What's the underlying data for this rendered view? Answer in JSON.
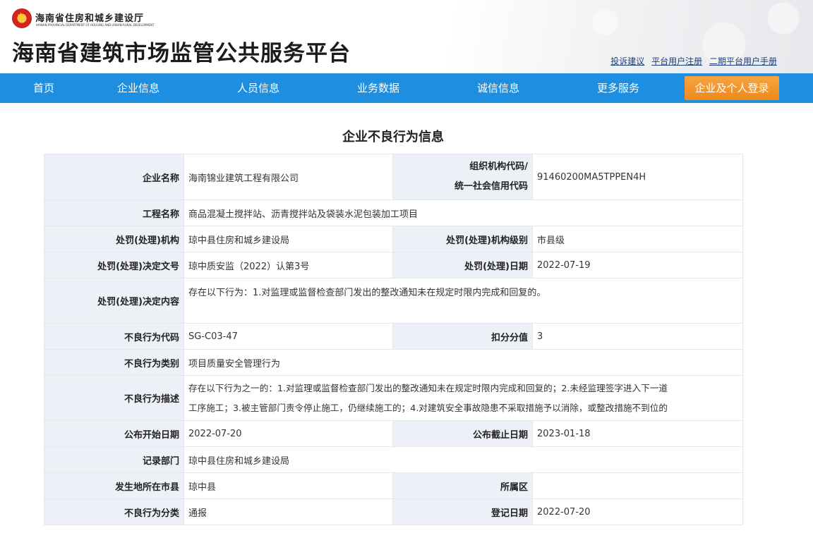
{
  "header": {
    "dept_cn": "海南省住房和城乡建设厅",
    "dept_en": "HAINAN PROVINCIAL DEPARTMENT OF HOUSING AND URBAN-RURAL DEVELOPMENT",
    "site_title": "海南省建筑市场监管公共服务平台",
    "links": [
      "投诉建议",
      "平台用户注册",
      "二期平台用户手册"
    ]
  },
  "nav": {
    "items": [
      "首页",
      "企业信息",
      "人员信息",
      "业务数据",
      "诚信信息",
      "更多服务"
    ],
    "login": "企业及个人登录"
  },
  "page": {
    "title": "企业不良行为信息"
  },
  "fields": {
    "company_name": {
      "label": "企业名称",
      "value": "海南锦业建筑工程有限公司"
    },
    "org_code": {
      "label_line1": "组织机构代码/",
      "label_line2": "统一社会信用代码",
      "value": "91460200MA5TPPEN4H"
    },
    "project_name": {
      "label": "工程名称",
      "value": "商品混凝土搅拌站、沥青搅拌站及袋装水泥包装加工项目"
    },
    "penalty_org": {
      "label": "处罚(处理)机构",
      "value": "琼中县住房和城乡建设局"
    },
    "penalty_org_level": {
      "label": "处罚(处理)机构级别",
      "value": "市县级"
    },
    "decision_no": {
      "label": "处罚(处理)决定文号",
      "value": "琼中质安监（2022）认第3号"
    },
    "penalty_date": {
      "label": "处罚(处理)日期",
      "value": "2022-07-19"
    },
    "decision_content": {
      "label": "处罚(处理)决定内容",
      "value": "存在以下行为：1.对监理或监督检查部门发出的整改通知未在规定时限内完成和回复的。"
    },
    "behavior_code": {
      "label": "不良行为代码",
      "value": "SG-C03-47"
    },
    "deduct_score": {
      "label": "扣分分值",
      "value": "3"
    },
    "behavior_category": {
      "label": "不良行为类别",
      "value": "项目质量安全管理行为"
    },
    "behavior_desc": {
      "label": "不良行为描述",
      "line1": "存在以下行为之一的：1.对监理或监督检查部门发出的整改通知未在规定时限内完成和回复的；2.未经监理签字进入下一道",
      "line2": "工序施工；3.被主管部门责令停止施工，仍继续施工的；4.对建筑安全事故隐患不采取措施予以消除，或整改措施不到位的"
    },
    "publish_start": {
      "label": "公布开始日期",
      "value": "2022-07-20"
    },
    "publish_end": {
      "label": "公布截止日期",
      "value": "2023-01-18"
    },
    "record_dept": {
      "label": "记录部门",
      "value": "琼中县住房和城乡建设局"
    },
    "city": {
      "label": "发生地所在市县",
      "value": "琼中县"
    },
    "district": {
      "label": "所属区",
      "value": ""
    },
    "behavior_class": {
      "label": "不良行为分类",
      "value": "通报"
    },
    "register_date": {
      "label": "登记日期",
      "value": "2022-07-20"
    }
  }
}
